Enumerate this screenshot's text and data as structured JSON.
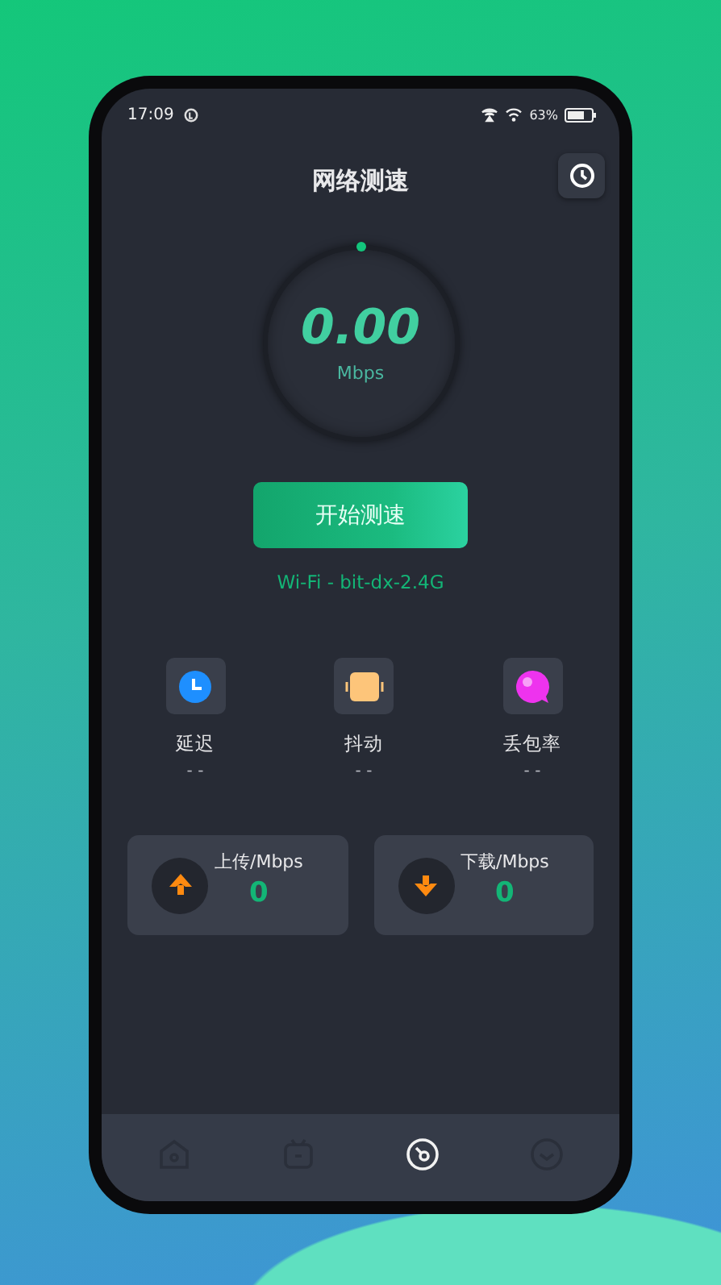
{
  "status_bar": {
    "time": "17:09",
    "battery_text": "63%"
  },
  "title": "网络测速",
  "gauge": {
    "value": "0.00",
    "unit": "Mbps"
  },
  "start_button": "开始测速",
  "network": "Wi-Fi - bit-dx-2.4G",
  "metrics": [
    {
      "kind": "latency",
      "label": "延迟",
      "value": "- -"
    },
    {
      "kind": "jitter",
      "label": "抖动",
      "value": "- -"
    },
    {
      "kind": "loss",
      "label": "丢包率",
      "value": "- -"
    }
  ],
  "transfers": [
    {
      "kind": "upload",
      "label": "上传/Mbps",
      "value": "0"
    },
    {
      "kind": "download",
      "label": "下载/Mbps",
      "value": "0"
    }
  ],
  "nav": [
    {
      "kind": "home",
      "selected": false
    },
    {
      "kind": "tv",
      "selected": false
    },
    {
      "kind": "speed",
      "selected": true
    },
    {
      "kind": "smile",
      "selected": false
    }
  ]
}
